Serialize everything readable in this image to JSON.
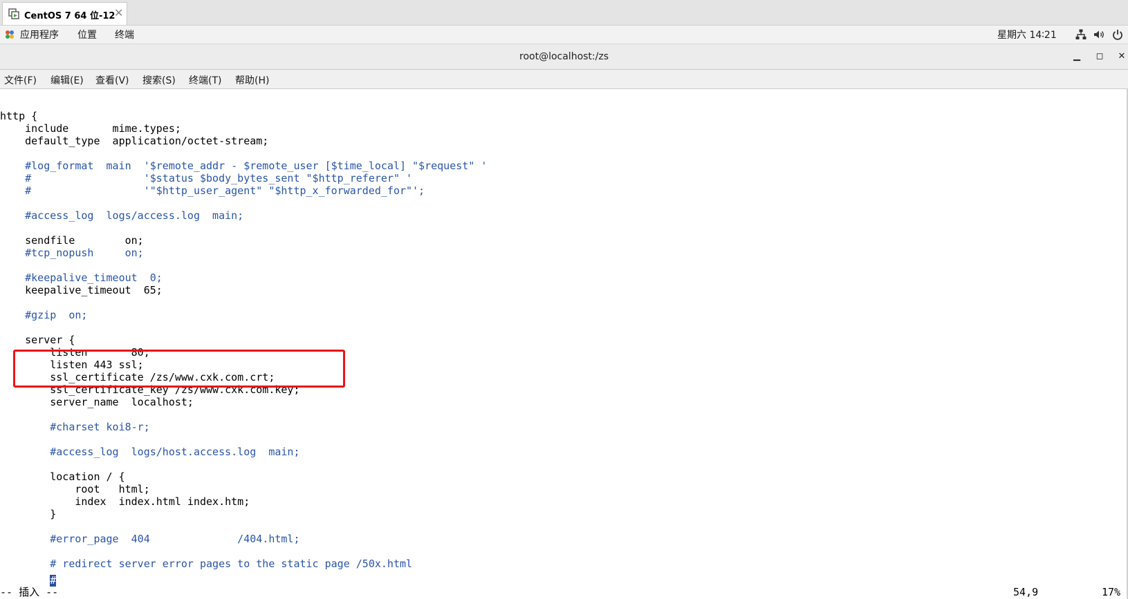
{
  "vmware_tab": {
    "label": "CentOS 7 64 位-12",
    "close": "✕"
  },
  "panel": {
    "apps_menu": "应用程序",
    "places_menu": "位置",
    "terminal_menu": "终端",
    "clock": "星期六 14∶21"
  },
  "window": {
    "title": "root@localhost:/zs",
    "minimize": "▁",
    "maximize": "◻",
    "close": "✕"
  },
  "menubar": {
    "file": "文件(F)",
    "edit": "编辑(E)",
    "view": "查看(V)",
    "search": "搜索(S)",
    "terminal": "终端(T)",
    "help": "帮助(H)"
  },
  "editor": {
    "lines": [
      {
        "text": "http {",
        "comment": false
      },
      {
        "text": "    include       mime.types;",
        "comment": false
      },
      {
        "text": "    default_type  application/octet-stream;",
        "comment": false
      },
      {
        "text": "",
        "comment": false
      },
      {
        "text": "    #log_format  main  '$remote_addr - $remote_user [$time_local] \"$request\" '",
        "comment": true
      },
      {
        "text": "    #                  '$status $body_bytes_sent \"$http_referer\" '",
        "comment": true
      },
      {
        "text": "    #                  '\"$http_user_agent\" \"$http_x_forwarded_for\"';",
        "comment": true
      },
      {
        "text": "",
        "comment": false
      },
      {
        "text": "    #access_log  logs/access.log  main;",
        "comment": true
      },
      {
        "text": "",
        "comment": false
      },
      {
        "text": "    sendfile        on;",
        "comment": false
      },
      {
        "text": "    #tcp_nopush     on;",
        "comment": true
      },
      {
        "text": "",
        "comment": false
      },
      {
        "text": "    #keepalive_timeout  0;",
        "comment": true
      },
      {
        "text": "    keepalive_timeout  65;",
        "comment": false
      },
      {
        "text": "",
        "comment": false
      },
      {
        "text": "    #gzip  on;",
        "comment": true
      },
      {
        "text": "",
        "comment": false
      },
      {
        "text": "    server {",
        "comment": false
      },
      {
        "text": "        listen       80;",
        "comment": false
      },
      {
        "text": "        listen 443 ssl;",
        "comment": false
      },
      {
        "text": "        ssl_certificate /zs/www.cxk.com.crt;",
        "comment": false
      },
      {
        "text": "        ssl_certificate_key /zs/www.cxk.com.key;",
        "comment": false
      },
      {
        "text": "        server_name  localhost;",
        "comment": false
      },
      {
        "text": "",
        "comment": false
      },
      {
        "text": "        #charset koi8-r;",
        "comment": true
      },
      {
        "text": "",
        "comment": false
      },
      {
        "text": "        #access_log  logs/host.access.log  main;",
        "comment": true
      },
      {
        "text": "",
        "comment": false
      },
      {
        "text": "        location / {",
        "comment": false
      },
      {
        "text": "            root   html;",
        "comment": false
      },
      {
        "text": "            index  index.html index.htm;",
        "comment": false
      },
      {
        "text": "        }",
        "comment": false
      },
      {
        "text": "",
        "comment": false
      },
      {
        "text": "        #error_page  404              /404.html;",
        "comment": true
      },
      {
        "text": "",
        "comment": false
      },
      {
        "text": "        # redirect server error pages to the static page /50x.html",
        "comment": true
      }
    ],
    "cursor_line_indent": "        ",
    "cursor_char": "#",
    "mode": "-- 插入 --",
    "position": "54,9",
    "percent": "17%"
  },
  "colors": {
    "comment": "#2a55a8",
    "highlight_box": "#e8141a",
    "cursor_bg": "#2a4f9e"
  }
}
